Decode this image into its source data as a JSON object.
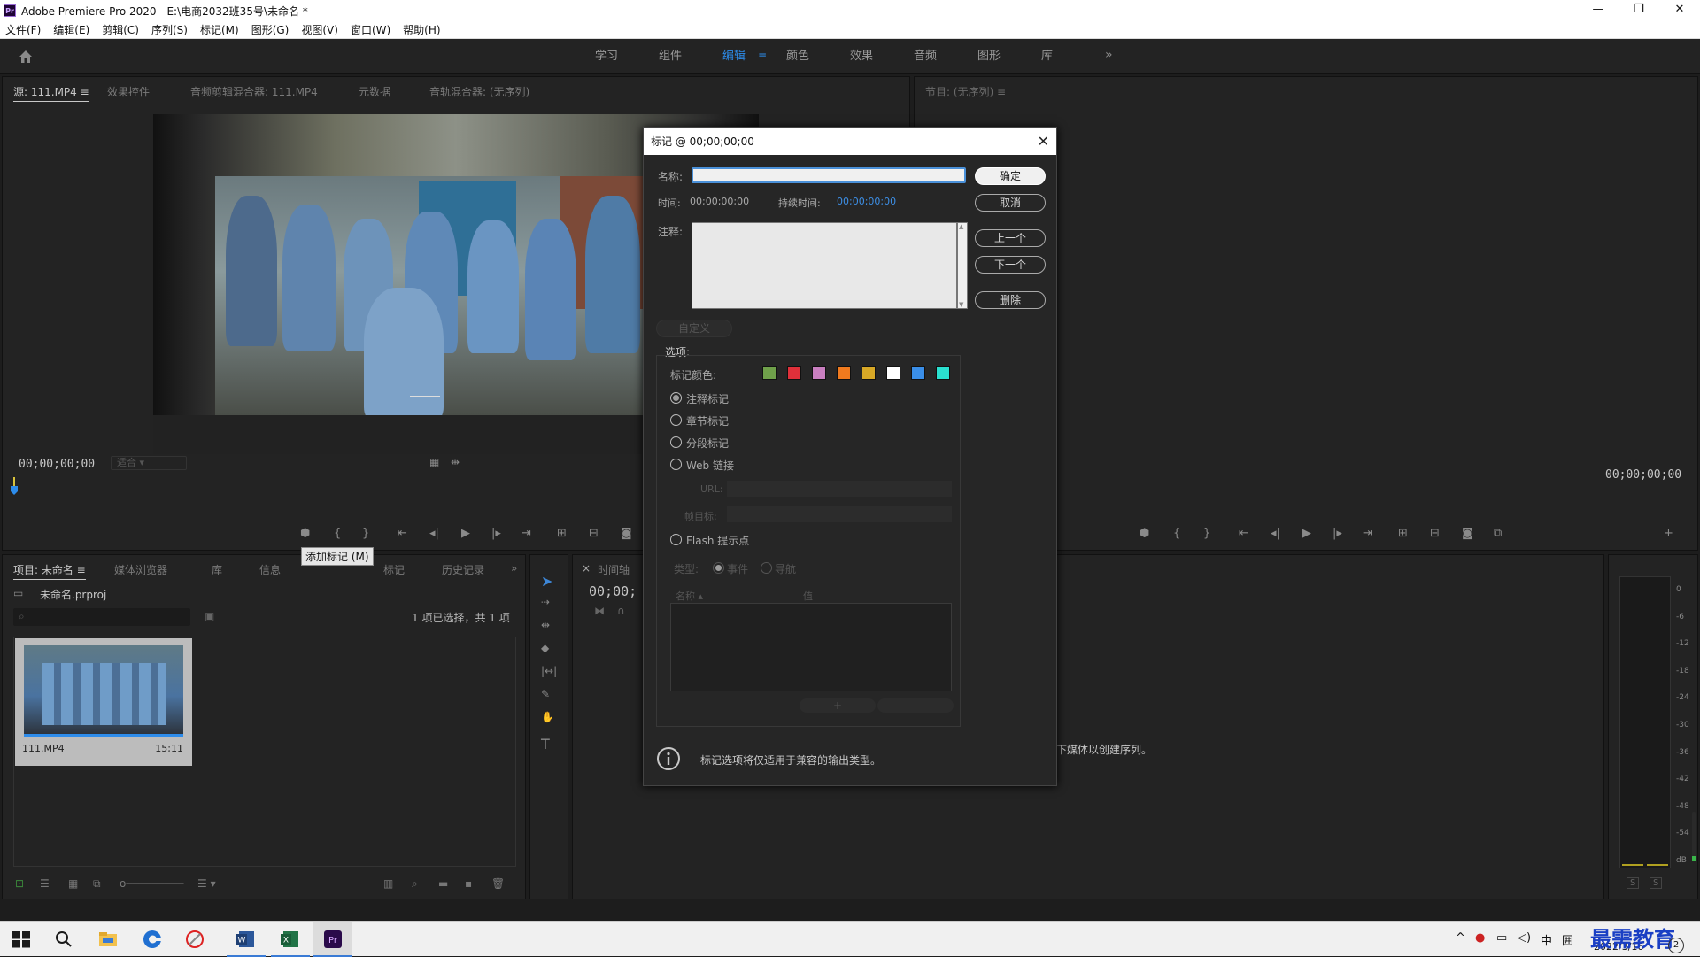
{
  "window": {
    "app_badge": "Pr",
    "title": "Adobe Premiere Pro 2020 - E:\\电商2032班35号\\未命名 *",
    "minimize": "—",
    "restore": "❐",
    "close": "✕"
  },
  "menu": [
    "文件(F)",
    "编辑(E)",
    "剪辑(C)",
    "序列(S)",
    "标记(M)",
    "图形(G)",
    "视图(V)",
    "窗口(W)",
    "帮助(H)"
  ],
  "workspace_tabs": [
    "学习",
    "组件",
    "编辑",
    "颜色",
    "效果",
    "音频",
    "图形",
    "库"
  ],
  "workspace_active": "编辑",
  "workspace_more": "»",
  "source_panel": {
    "tabs": [
      "源: 111.MP4 ≡",
      "效果控件",
      "音频剪辑混合器: 111.MP4",
      "元数据",
      "音轨混合器: (无序列)"
    ],
    "timecode": "00;00;00;00",
    "fit": "适合"
  },
  "program_panel": {
    "tab": "节目: (无序列) ≡",
    "timecode": "00;00;00;00"
  },
  "project_panel": {
    "tabs": [
      "项目: 未命名 ≡",
      "媒体浏览器",
      "库",
      "信息",
      "标记",
      "历史记录"
    ],
    "more": "»",
    "file": "未命名.prproj",
    "selection": "1 项已选择，共 1 项",
    "clip_name": "111.MP4",
    "clip_duration": "15;11"
  },
  "tooltip": "添加标记 (M)",
  "timeline_panel": {
    "tab": "时间轴",
    "timecode": "00;00;",
    "empty_hint": "下媒体以创建序列。"
  },
  "meter": {
    "labels": [
      "0",
      "-6",
      "-12",
      "-18",
      "-24",
      "-30",
      "-36",
      "-42",
      "-48",
      "-54",
      "dB"
    ],
    "solo_a": "S",
    "solo_b": "S"
  },
  "dialog": {
    "title": "标记 @ 00;00;00;00",
    "close": "✕",
    "name_label": "名称:",
    "name_value": "",
    "time_label": "时间:",
    "time_value": "00;00;00;00",
    "duration_label": "持续时间:",
    "duration_value": "00;00;00;00",
    "comment_label": "注释:",
    "comment_value": "",
    "btn_ok": "确定",
    "btn_cancel": "取消",
    "btn_prev": "上一个",
    "btn_next": "下一个",
    "btn_delete": "删除",
    "custom": "自定义",
    "options_label": "选项:",
    "color_label": "标记颜色:",
    "colors": [
      "#6fa04a",
      "#e0303a",
      "#c97fc0",
      "#f07a1e",
      "#d8a826",
      "#ffffff",
      "#3a8ee8",
      "#2ae0d0"
    ],
    "types": [
      {
        "label": "注释标记",
        "selected": true
      },
      {
        "label": "章节标记",
        "selected": false
      },
      {
        "label": "分段标记",
        "selected": false
      },
      {
        "label": "Web 链接",
        "selected": false
      }
    ],
    "url_label": "URL:",
    "frame_label": "帧目标:",
    "flash_label": "Flash 提示点",
    "type_label": "类型:",
    "event_label": "事件",
    "nav_label": "导航",
    "col_name": "名称 ▴",
    "col_value": "值",
    "add": "+",
    "remove": "-",
    "info": "标记选项将仅适用于兼容的输出类型。"
  },
  "taskbar": {
    "tray_lang": "中",
    "tray_ime": "囲",
    "date": "2022/3/16",
    "watermark": "最需教育",
    "notify_count": "2"
  }
}
